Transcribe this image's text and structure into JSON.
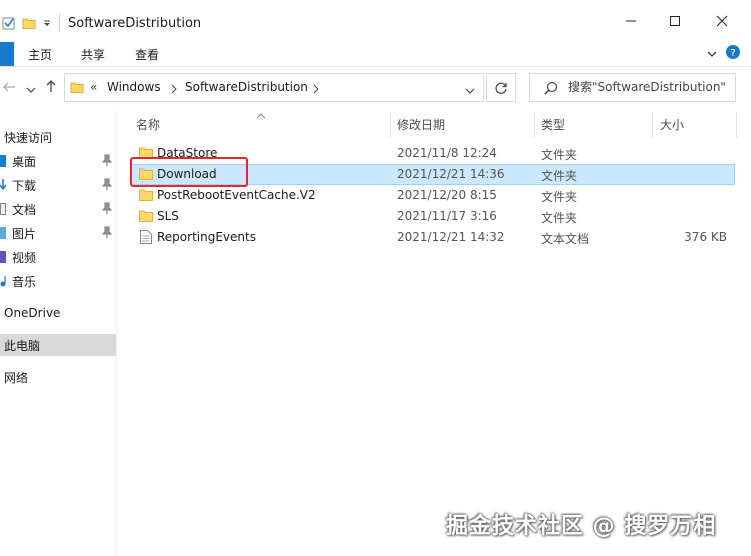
{
  "window": {
    "title": "SoftwareDistribution"
  },
  "ribbon": {
    "tabs": [
      "主页",
      "共享",
      "查看"
    ]
  },
  "address": {
    "segments": [
      "«",
      "Windows",
      "SoftwareDistribution"
    ]
  },
  "search": {
    "placeholder": "搜索\"SoftwareDistribution\""
  },
  "nav": {
    "items": [
      {
        "label": "快速访问",
        "icon": "star-icon"
      },
      {
        "label": "桌面",
        "icon": "desktop-icon",
        "pinned": true
      },
      {
        "label": "下载",
        "icon": "download-icon",
        "pinned": true
      },
      {
        "label": "文档",
        "icon": "document-icon",
        "pinned": true
      },
      {
        "label": "图片",
        "icon": "picture-icon",
        "pinned": true
      },
      {
        "label": "视频",
        "icon": "video-icon"
      },
      {
        "label": "音乐",
        "icon": "music-icon"
      },
      {
        "label": "OneDrive",
        "icon": "cloud-icon"
      },
      {
        "label": "此电脑",
        "icon": "computer-icon",
        "selected": true
      },
      {
        "label": "网络",
        "icon": "network-icon"
      }
    ]
  },
  "columns": {
    "name": "名称",
    "modified": "修改日期",
    "type": "类型",
    "size": "大小"
  },
  "files": [
    {
      "name": "DataStore",
      "modified": "2021/11/8 12:24",
      "type": "文件夹",
      "size": "",
      "icon": "folder-icon"
    },
    {
      "name": "Download",
      "modified": "2021/12/21 14:36",
      "type": "文件夹",
      "size": "",
      "icon": "folder-icon",
      "selected": true
    },
    {
      "name": "PostRebootEventCache.V2",
      "modified": "2021/12/20 8:15",
      "type": "文件夹",
      "size": "",
      "icon": "folder-icon"
    },
    {
      "name": "SLS",
      "modified": "2021/11/17 3:16",
      "type": "文件夹",
      "size": "",
      "icon": "folder-icon"
    },
    {
      "name": "ReportingEvents",
      "modified": "2021/12/21 14:32",
      "type": "文本文档",
      "size": "376 KB",
      "icon": "text-file-icon"
    }
  ],
  "watermark": "掘金技术社区 @ 搜罗万相",
  "colors": {
    "accent": "#1979ca",
    "selection": "#cce8ff",
    "selection_border": "#99d1ff",
    "highlight": "#e32a2a",
    "folder": "#ffd766"
  }
}
